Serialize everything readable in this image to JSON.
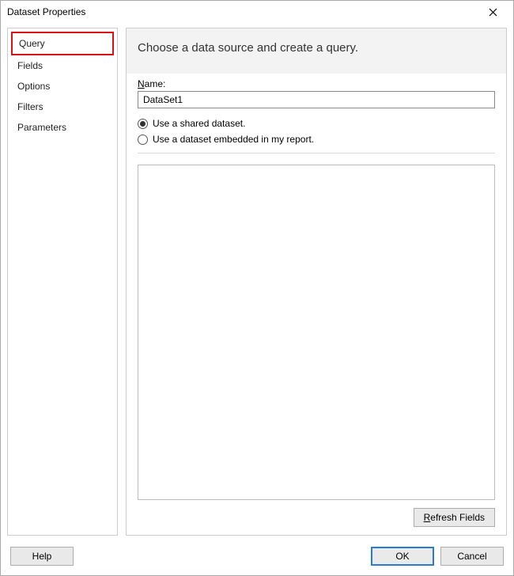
{
  "title": "Dataset Properties",
  "sidebar": {
    "items": [
      {
        "label": "Query",
        "selected": true
      },
      {
        "label": "Fields",
        "selected": false
      },
      {
        "label": "Options",
        "selected": false
      },
      {
        "label": "Filters",
        "selected": false
      },
      {
        "label": "Parameters",
        "selected": false
      }
    ]
  },
  "main": {
    "heading": "Choose a data source and create a query.",
    "name_label_prefix": "N",
    "name_label_rest": "ame:",
    "name_value": "DataSet1",
    "radio_shared": "Use a shared dataset.",
    "radio_embedded": "Use a dataset embedded in my report.",
    "selected_option": "shared",
    "refresh_prefix": "R",
    "refresh_rest": "efresh Fields"
  },
  "footer": {
    "help": "Help",
    "ok": "OK",
    "cancel": "Cancel"
  }
}
